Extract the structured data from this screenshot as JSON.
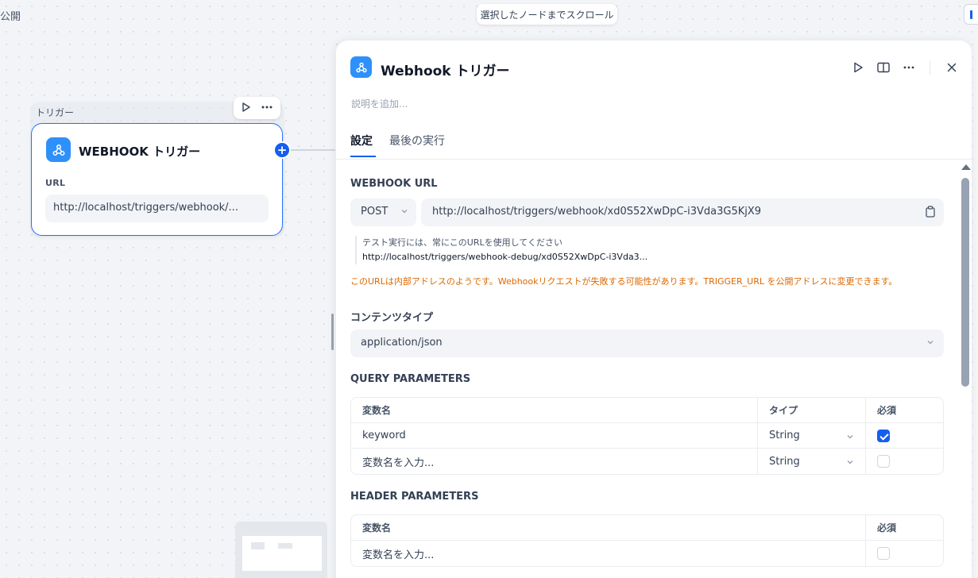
{
  "canvas": {
    "top_left_label": "公開",
    "scroll_to_node_button": "選択したノードまでスクロール"
  },
  "node": {
    "group_label": "トリガー",
    "title": "WEBHOOK トリガー",
    "url_label": "URL",
    "url_value": "http://localhost/triggers/webhook/..."
  },
  "panel": {
    "title": "Webhook トリガー",
    "description_placeholder": "説明を追加...",
    "tabs": [
      "設定",
      "最後の実行"
    ],
    "webhook_url_label": "WEBHOOK URL",
    "method": "POST",
    "url": "http://localhost/triggers/webhook/xd0S52XwDpC-i3Vda3G5KjX9",
    "debug_note": "テスト実行には、常にこのURLを使用してください",
    "debug_url": "http://localhost/triggers/webhook-debug/xd0S52XwDpC-i3Vda3...",
    "warning": "このURLは内部アドレスのようです。Webhookリクエストが失敗する可能性があります。TRIGGER_URL を公開アドレスに変更できます。",
    "content_type_label": "コンテンツタイプ",
    "content_type": "application/json",
    "query_params": {
      "label": "QUERY PARAMETERS",
      "headers": [
        "変数名",
        "タイプ",
        "必須"
      ],
      "rows": [
        {
          "name": "keyword",
          "type": "String",
          "required": true
        },
        {
          "name_placeholder": "変数名を入力...",
          "type": "String",
          "required": false
        }
      ]
    },
    "header_params": {
      "label": "HEADER PARAMETERS",
      "headers": [
        "変数名",
        "必須"
      ],
      "rows": [
        {
          "name_placeholder": "変数名を入力...",
          "required": false
        }
      ]
    }
  },
  "colors": {
    "accent": "#155eef",
    "node_icon": "#2e90fa",
    "warning": "#dc6803"
  }
}
